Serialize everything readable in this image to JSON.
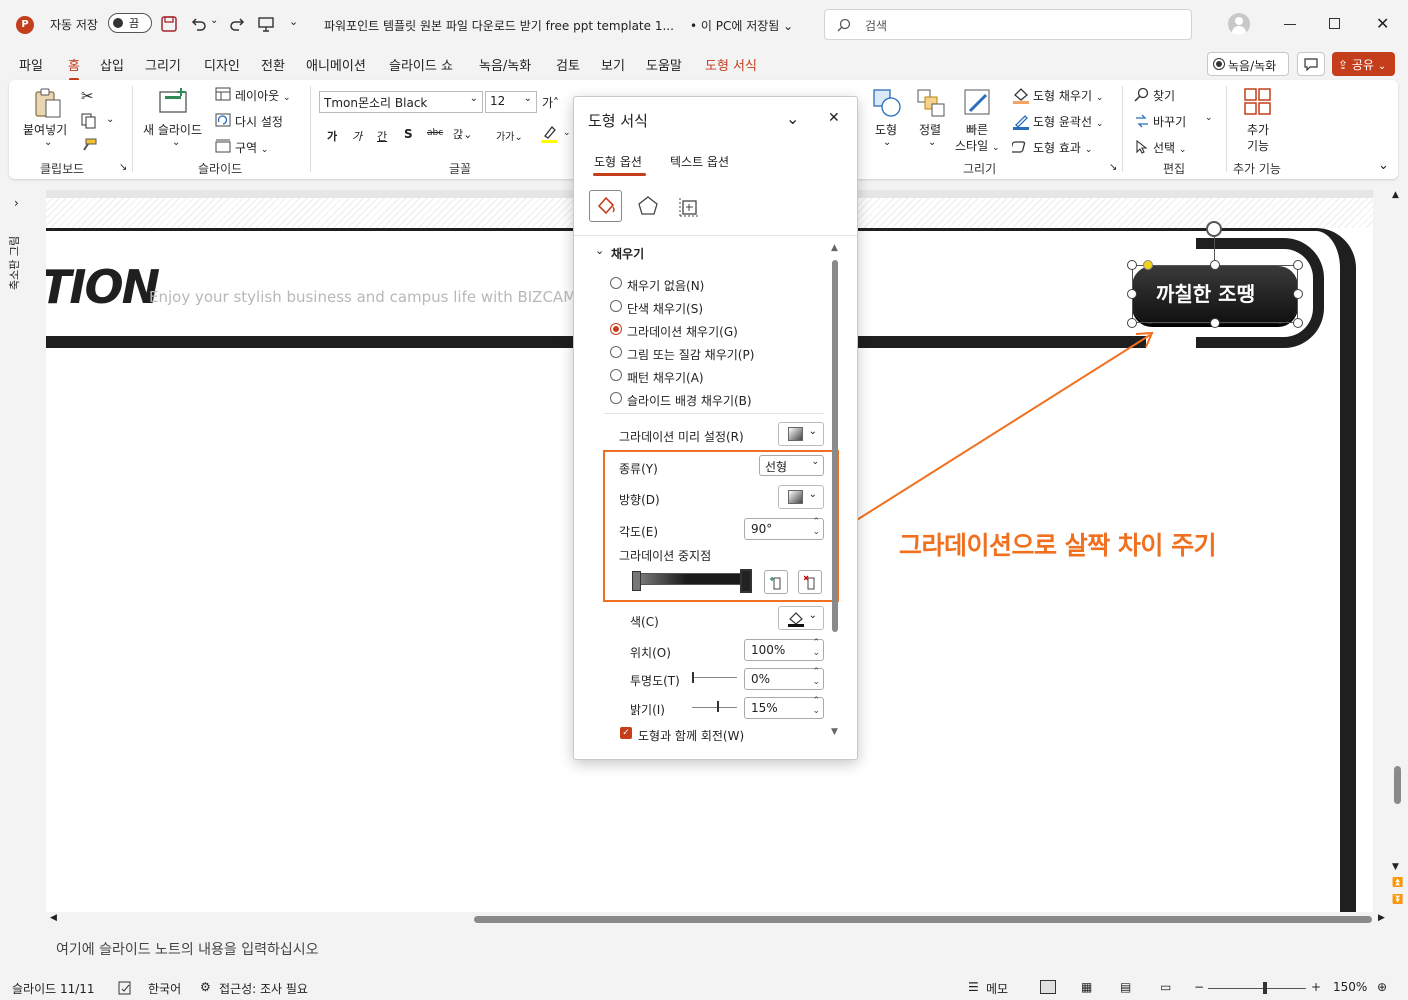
{
  "titlebar": {
    "autosave_label": "자동 저장",
    "autosave_state": "끔",
    "doc_title": "파워포인트 템플릿 원본 파일 다운로드 받기 free ppt template 1...",
    "save_location": "• 이 PC에 저장됨",
    "search_placeholder": "검색"
  },
  "menu": {
    "items": [
      "파일",
      "홈",
      "삽입",
      "그리기",
      "디자인",
      "전환",
      "애니메이션",
      "슬라이드 쇼",
      "녹음/녹화",
      "검토",
      "보기",
      "도움말",
      "도형 서식"
    ],
    "active": "홈",
    "record_button": "녹음/녹화",
    "share_button": "공유"
  },
  "ribbon": {
    "clipboard": {
      "paste": "붙여넣기",
      "group": "클립보드"
    },
    "slides": {
      "new_slide": "새 슬라이드",
      "layout": "레이아웃",
      "reset": "다시 설정",
      "section": "구역",
      "group": "슬라이드"
    },
    "font": {
      "font_name": "Tmon몬소리 Black",
      "font_size": "12",
      "group": "글꼴"
    },
    "drawing": {
      "shape": "도형",
      "arrange": "정렬",
      "quick_styles_1": "빠른",
      "quick_styles_2": "스타일",
      "fill": "도형 채우기",
      "outline": "도형 윤곽선",
      "effects": "도형 효과",
      "group": "그리기"
    },
    "editing": {
      "find": "찾기",
      "replace": "바꾸기",
      "select": "선택",
      "group": "편집"
    },
    "addins": {
      "label_1": "추가",
      "label_2": "기능",
      "group": "추가 기능"
    }
  },
  "left_rail": {
    "thumbnails_label": "축소판 그림"
  },
  "slide": {
    "title_fragment": "TION",
    "subtitle": "Enjoy your stylish business and campus life with BIZCAM",
    "button_text": "까칠한 조땡",
    "annotation": "그라데이션으로 살짝 차이 주기"
  },
  "panel": {
    "title": "도형 서식",
    "tabs": [
      "도형 옵션",
      "텍스트 옵션"
    ],
    "active_tab": "도형 옵션",
    "section": "채우기",
    "fill_options": [
      "채우기 없음(N)",
      "단색 채우기(S)",
      "그라데이션 채우기(G)",
      "그림 또는 질감 채우기(P)",
      "패턴 채우기(A)",
      "슬라이드 배경 채우기(B)"
    ],
    "fill_selected": "그라데이션 채우기(G)",
    "gradient_preset_label": "그라데이션 미리 설정(R)",
    "type_label": "종류(Y)",
    "type_value": "선형",
    "direction_label": "방향(D)",
    "angle_label": "각도(E)",
    "angle_value": "90°",
    "stops_label": "그라데이션 중지점",
    "color_label": "색(C)",
    "position_label": "위치(O)",
    "position_value": "100%",
    "transparency_label": "투명도(T)",
    "transparency_value": "0%",
    "brightness_label": "밝기(I)",
    "brightness_value": "15%",
    "rotate_with_shape": "도형과 함께 회전(W)"
  },
  "notes": {
    "placeholder": "여기에 슬라이드 노트의 내용을 입력하십시오"
  },
  "status": {
    "slide_counter": "슬라이드 11/11",
    "language": "한국어",
    "accessibility": "접근성: 조사 필요",
    "notes_button": "메모",
    "zoom": "150%"
  },
  "colors": {
    "accent": "#c43e1c",
    "annotation": "#f07020",
    "dark": "#1f1f1f"
  }
}
